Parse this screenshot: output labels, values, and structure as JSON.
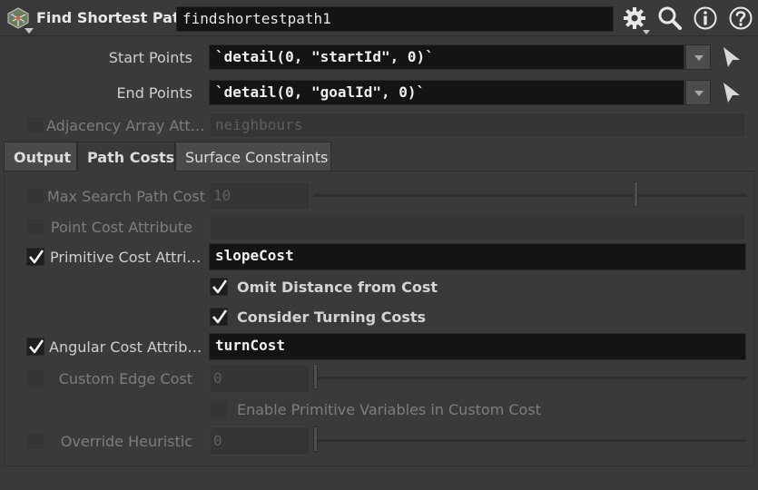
{
  "header": {
    "node_type": "Find Shortest Path",
    "node_name": "findshortestpath1",
    "icons": [
      "node-type-icon",
      "gear-icon",
      "search-icon",
      "info-icon",
      "help-icon"
    ]
  },
  "params": {
    "start_points": {
      "label": "Start Points",
      "value": "`detail(0, \"startId\", 0)`"
    },
    "end_points": {
      "label": "End Points",
      "value": "`detail(0, \"goalId\", 0)`"
    },
    "adjacency": {
      "label": "Adjacency Array Att…",
      "value": "neighbours",
      "checked": false,
      "enabled": false
    }
  },
  "tabs": [
    {
      "label": "Output",
      "active": false
    },
    {
      "label": "Path Costs",
      "active": true
    },
    {
      "label": "Surface Constraints",
      "active": false
    }
  ],
  "path_costs": {
    "max_search": {
      "label": "Max Search Path Cost",
      "value": "10",
      "checked": false,
      "enabled": false,
      "slider_fraction": 0.74
    },
    "point_cost": {
      "label": "Point Cost Attribute",
      "value": "",
      "checked": false,
      "enabled": false
    },
    "prim_cost": {
      "label": "Primitive Cost Attri…",
      "value": "slopeCost",
      "checked": true,
      "enabled": true
    },
    "omit_distance": {
      "label": "Omit Distance from Cost",
      "checked": true
    },
    "turning_costs": {
      "label": "Consider Turning Costs",
      "checked": true
    },
    "angular_cost": {
      "label": "Angular Cost Attrib…",
      "value": "turnCost",
      "checked": true,
      "enabled": true
    },
    "custom_edge": {
      "label": "Custom Edge Cost",
      "value": "0",
      "checked": false,
      "enabled": false
    },
    "prim_vars": {
      "label": "Enable Primitive Variables in Custom Cost",
      "checked": false,
      "enabled": false
    },
    "override_heuristic": {
      "label": "Override Heuristic",
      "value": "0",
      "checked": false,
      "enabled": false
    }
  },
  "colors": {
    "background": "#3a3a3a",
    "field_bg": "#141414",
    "text": "#d2d2d2",
    "dim_text": "#7d7d7d"
  }
}
